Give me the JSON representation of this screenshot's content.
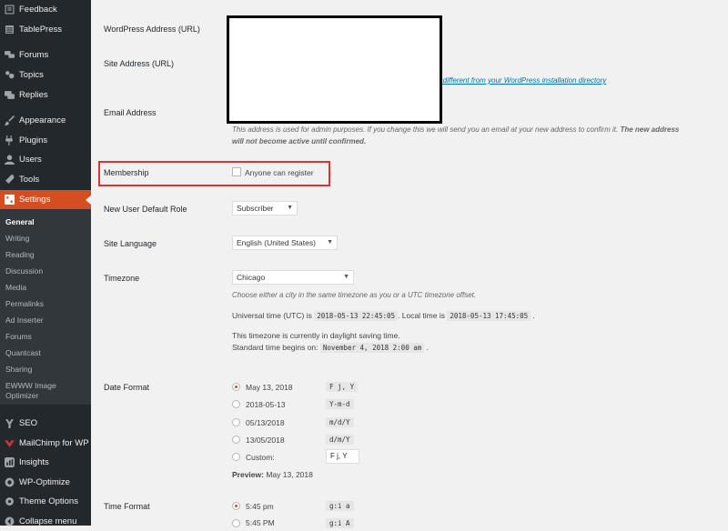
{
  "sidebar": {
    "items": [
      {
        "label": "Feedback",
        "icon": "feedback-icon"
      },
      {
        "label": "TablePress",
        "icon": "table-icon"
      },
      {
        "label": "Forums",
        "icon": "forums-icon"
      },
      {
        "label": "Topics",
        "icon": "topics-icon"
      },
      {
        "label": "Replies",
        "icon": "replies-icon"
      },
      {
        "label": "Appearance",
        "icon": "brush-icon"
      },
      {
        "label": "Plugins",
        "icon": "plugin-icon"
      },
      {
        "label": "Users",
        "icon": "user-icon"
      },
      {
        "label": "Tools",
        "icon": "wrench-icon"
      },
      {
        "label": "Settings",
        "icon": "settings-icon"
      }
    ],
    "submenu": [
      "General",
      "Writing",
      "Reading",
      "Discussion",
      "Media",
      "Permalinks",
      "Ad Inserter",
      "Forums",
      "Quantcast",
      "Sharing",
      "EWWW Image Optimizer"
    ],
    "items2": [
      {
        "label": "SEO",
        "icon": "yoast-icon"
      },
      {
        "label": "MailChimp for WP",
        "icon": "mailchimp-icon"
      },
      {
        "label": "Insights",
        "icon": "insights-icon"
      },
      {
        "label": "WP-Optimize",
        "icon": "optimize-icon"
      },
      {
        "label": "Theme Options",
        "icon": "gear-icon"
      },
      {
        "label": "Collapse menu",
        "icon": "collapse-icon"
      }
    ]
  },
  "form": {
    "wp_address_label": "WordPress Address (URL)",
    "site_address_label": "Site Address (URL)",
    "site_address_link": "e different from your WordPress installation directory",
    "email_label": "Email Address",
    "email_desc": "This address is used for admin purposes. If you change this we will send you an email at your new address to confirm it.",
    "email_desc_bold": "The new address",
    "email_desc_bold2": "will not become active until confirmed.",
    "membership_label": "Membership",
    "membership_checkbox": "Anyone can register",
    "role_label": "New User Default Role",
    "role_value": "Subscriber",
    "language_label": "Site Language",
    "language_value": "English (United States)",
    "timezone_label": "Timezone",
    "timezone_value": "Chicago",
    "timezone_desc": "Choose either a city in the same timezone as you or a UTC timezone offset.",
    "utc_prefix": "Universal time (UTC) is",
    "utc_time": "2018-05-13 22:45:05",
    "local_prefix": ". Local time is",
    "local_time": "2018-05-13 17:45:05",
    "period": ".",
    "dst_line": "This timezone is currently in daylight saving time.",
    "std_prefix": "Standard time begins on:",
    "std_time": "November 4, 2018 2:00 am",
    "date_format_label": "Date Format",
    "date_options": [
      {
        "label": "May 13, 2018",
        "code": "F j, Y"
      },
      {
        "label": "2018-05-13",
        "code": "Y-m-d"
      },
      {
        "label": "05/13/2018",
        "code": "m/d/Y"
      },
      {
        "label": "13/05/2018",
        "code": "d/m/Y"
      },
      {
        "label": "Custom:",
        "code": "F j, Y"
      }
    ],
    "preview_label": "Preview:",
    "preview_value": "May 13, 2018",
    "time_format_label": "Time Format",
    "time_options": [
      {
        "label": "5:45 pm",
        "code": "g:i a"
      },
      {
        "label": "5:45 PM",
        "code": "g:i A"
      }
    ]
  },
  "colors": {
    "accent": "#d54e21",
    "highlight": "#dc3232"
  }
}
